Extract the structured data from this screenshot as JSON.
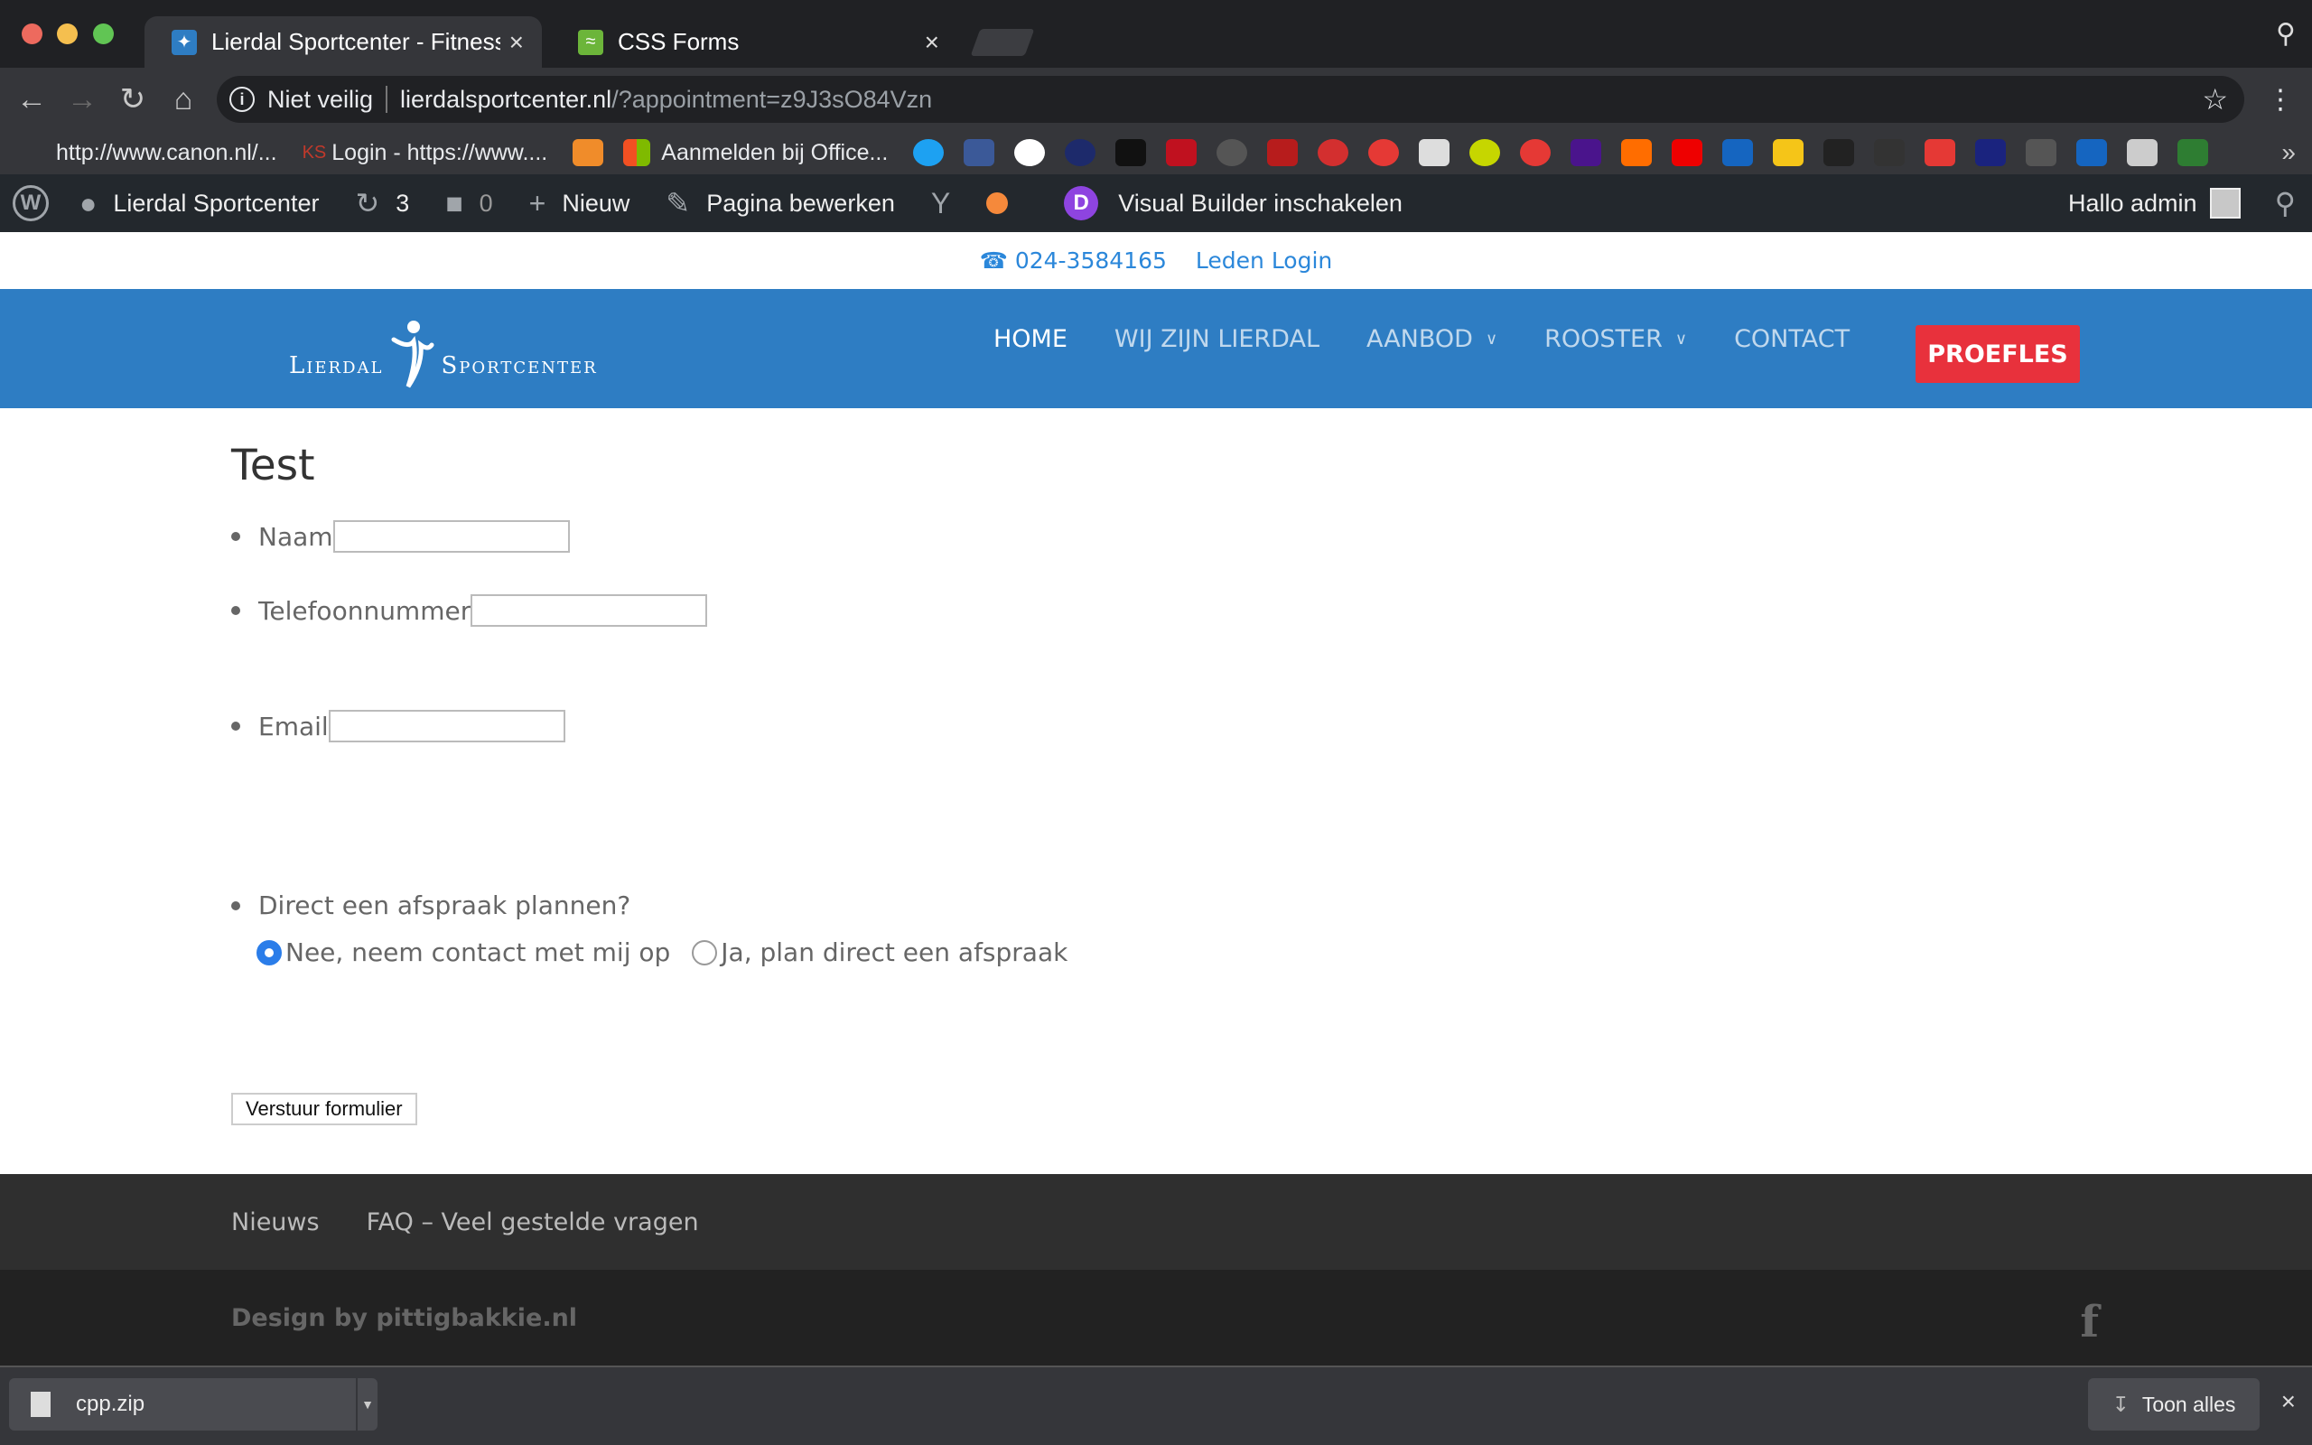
{
  "browser": {
    "tabs": [
      {
        "title": "Lierdal Sportcenter - Fitness, G",
        "active": true
      },
      {
        "title": "CSS Forms",
        "active": false
      }
    ],
    "address": {
      "security": "Niet veilig",
      "host": "lierdalsportcenter.nl",
      "path": "/?appointment=z9J3sO84Vzn"
    },
    "bookmarks": [
      "http://www.canon.nl/...",
      "Login - https://www....",
      "Aanmelden bij Office..."
    ],
    "bookmark_prefix": "KS"
  },
  "adminbar": {
    "site_name": "Lierdal Sportcenter",
    "updates_count": "3",
    "comments_count": "0",
    "new_label": "Nieuw",
    "edit_label": "Pagina bewerken",
    "visual_builder_label": "Visual Builder inschakelen",
    "divi_badge": "D",
    "greeting": "Hallo admin"
  },
  "topbar": {
    "phone": "024-3584165",
    "members_login": "Leden Login"
  },
  "header": {
    "logo_left": "Lierdal",
    "logo_right": "Sportcenter",
    "nav": [
      {
        "label": "HOME",
        "current": true,
        "dropdown": false
      },
      {
        "label": "WIJ ZIJN LIERDAL",
        "current": false,
        "dropdown": false
      },
      {
        "label": "AANBOD",
        "current": false,
        "dropdown": true
      },
      {
        "label": "ROOSTER",
        "current": false,
        "dropdown": true
      },
      {
        "label": "CONTACT",
        "current": false,
        "dropdown": false
      }
    ],
    "cta": "PROEFLES"
  },
  "content": {
    "title": "Test",
    "fields": {
      "name_label": "Naam",
      "phone_label": "Telefoonnummer",
      "email_label": "Email",
      "appointment_question": "Direct een afspraak plannen?"
    },
    "radio_options": [
      {
        "label": "Nee, neem contact met mij op",
        "checked": true
      },
      {
        "label": "Ja, plan direct een afspraak",
        "checked": false
      }
    ],
    "submit_label": "Verstuur formulier"
  },
  "footer": {
    "nav": [
      "Nieuws",
      "FAQ – Veel gestelde vragen"
    ],
    "credit": "Design by pittigbakkie.nl"
  },
  "downloads": {
    "file_name": "cpp.zip",
    "show_all_label": "Toon alles"
  },
  "colors": {
    "header_blue": "#2e7dc3",
    "cta_red": "#e8313c",
    "link_blue": "#2b87da"
  }
}
